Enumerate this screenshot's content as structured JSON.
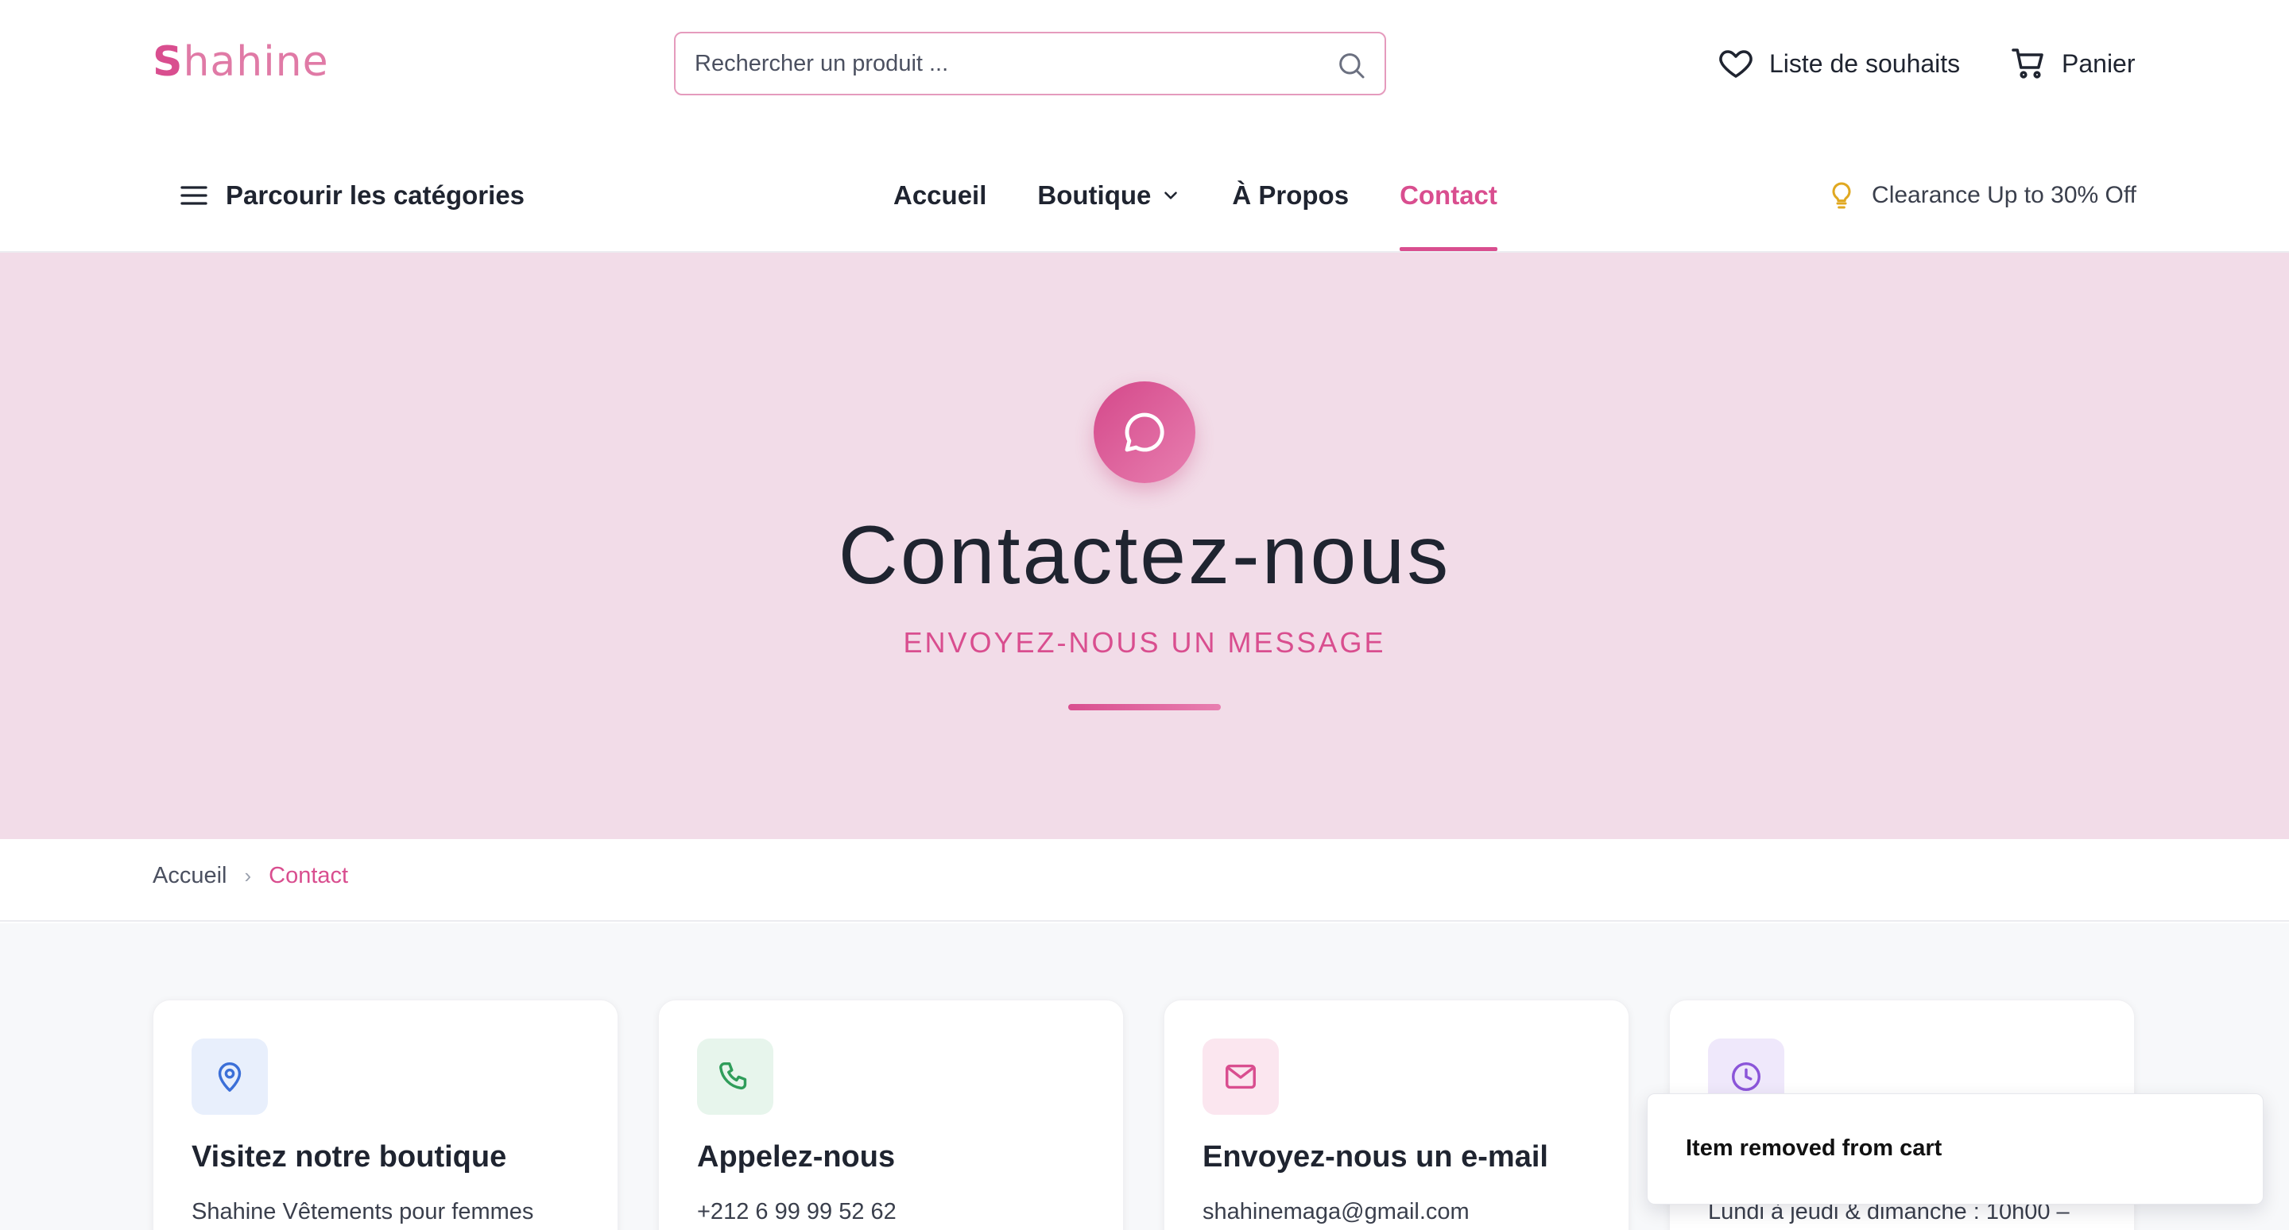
{
  "header": {
    "logo_mark": "S",
    "logo_rest": "hahine",
    "search_placeholder": "Rechercher un produit ...",
    "wishlist_label": "Liste de souhaits",
    "cart_label": "Panier"
  },
  "nav": {
    "browse_label": "Parcourir les catégories",
    "links": [
      {
        "label": "Accueil",
        "active": false
      },
      {
        "label": "Boutique",
        "active": false,
        "has_dropdown": true
      },
      {
        "label": "À Propos",
        "active": false
      },
      {
        "label": "Contact",
        "active": true
      }
    ],
    "promo_label": "Clearance Up to 30% Off"
  },
  "hero": {
    "icon": "message-bubble-icon",
    "title": "Contactez-nous",
    "subtitle": "ENVOYEZ-NOUS UN MESSAGE"
  },
  "breadcrumb": {
    "home": "Accueil",
    "separator": "›",
    "current": "Contact"
  },
  "cards": [
    {
      "icon": "map-pin-icon",
      "title": "Visitez notre boutique",
      "text": "Shahine Vêtements pour femmes"
    },
    {
      "icon": "phone-icon",
      "title": "Appelez-nous",
      "text": "+212 6 99 99 52 62"
    },
    {
      "icon": "mail-icon",
      "title": "Envoyez-nous un e-mail",
      "text": "shahinemaga@gmail.com"
    },
    {
      "icon": "clock-icon",
      "title": "",
      "text": "Lundi à jeudi & dimanche : 10h00 –"
    }
  ],
  "toast": {
    "message": "Item removed from cart"
  },
  "colors": {
    "accent": "#d94e8f",
    "hero_bg": "#f2dce8",
    "promo_icon": "#e0a820"
  }
}
